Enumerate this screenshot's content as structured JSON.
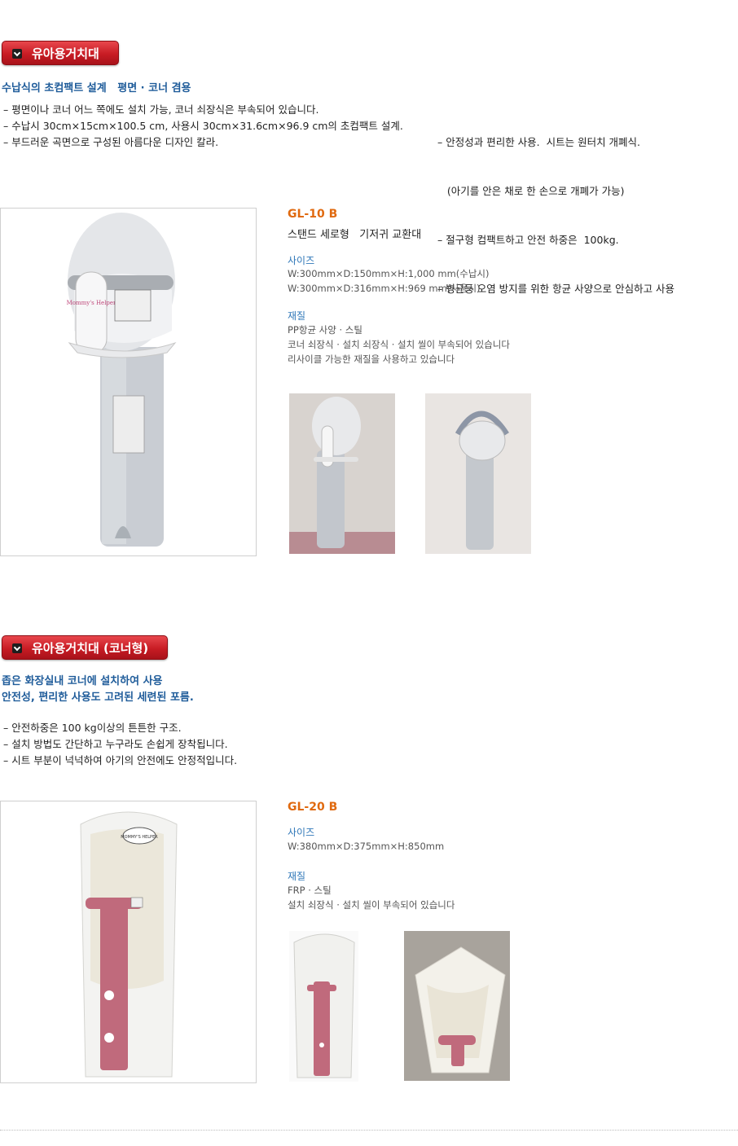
{
  "section1": {
    "title": "유아용거치대",
    "tagline": "수납식의 초컴팩트 설계   평면 · 코너 겸용",
    "bullets_left": [
      "– 평면이나 코너 어느 쪽에도 설치 가능, 코너 쇠장식은 부속되어 있습니다.",
      "– 수납시 30cm×15cm×100.5 cm, 사용시 30cm×31.6cm×96.9 cm의 초컴팩트 설계.",
      "– 부드러운 곡면으로 구성된 아름다운 디자인  칼라."
    ],
    "bullets_right": [
      "– 안정성과 편리한 사용.  시트는 원터치 개폐식.",
      "   (아기를 안은 채로 한 손으로 개폐가 가능)",
      "– 절구형 컴팩트하고 안전 하중은  100kg.",
      "– 병균등 오염 방지를 위한 항균 사양으로 안심하고 사용"
    ],
    "product": {
      "model": "GL-10 B",
      "desc": "스탠드 세로형   기저귀 교환대",
      "size_label": "사이즈",
      "size_lines": [
        "W:300mm×D:150mm×H:1,000 mm(수납시)",
        "W:300mm×D:316mm×H:969 mm(사용시)"
      ],
      "material_label": "재질",
      "material_lines": [
        "PP항균 사양 · 스틸",
        "코너 쇠장식 · 설치 쇠장식 · 설치 씰이 부속되어 있습니다",
        "리사이클 가능한 재질을 사용하고 있습니다"
      ],
      "logo_text": "Mommy's Helper"
    }
  },
  "section2": {
    "title": "유아용거치대 (코너형)",
    "tagline_lines": [
      "좁은 화장실내 코너에 설치하여 사용",
      "안전성, 편리한 사용도 고려된 세련된 포름."
    ],
    "bullets": [
      "– 안전하중은 100 kg이상의 튼튼한 구조.",
      "– 설치 방법도 간단하고 누구라도 손쉽게 장착됩니다.",
      "– 시트 부분이 넉넉하여 아기의 안전에도 안정적입니다."
    ],
    "product": {
      "model": "GL-20 B",
      "size_label": "사이즈",
      "size_lines": [
        "W:380mm×D:375mm×H:850mm"
      ],
      "material_label": "재질",
      "material_lines": [
        "FRP · 스틸",
        "설치 쇠장식 · 설치 씰이 부속되어 있습니다"
      ],
      "logo_text": "MOMMY'S HELPER"
    }
  },
  "colors": {
    "accent_red": "#c81c24",
    "tagline_blue": "#1f5c9a",
    "model_orange": "#e06a10",
    "label_blue": "#2f77b8",
    "seat_pink": "#c06a7c"
  }
}
